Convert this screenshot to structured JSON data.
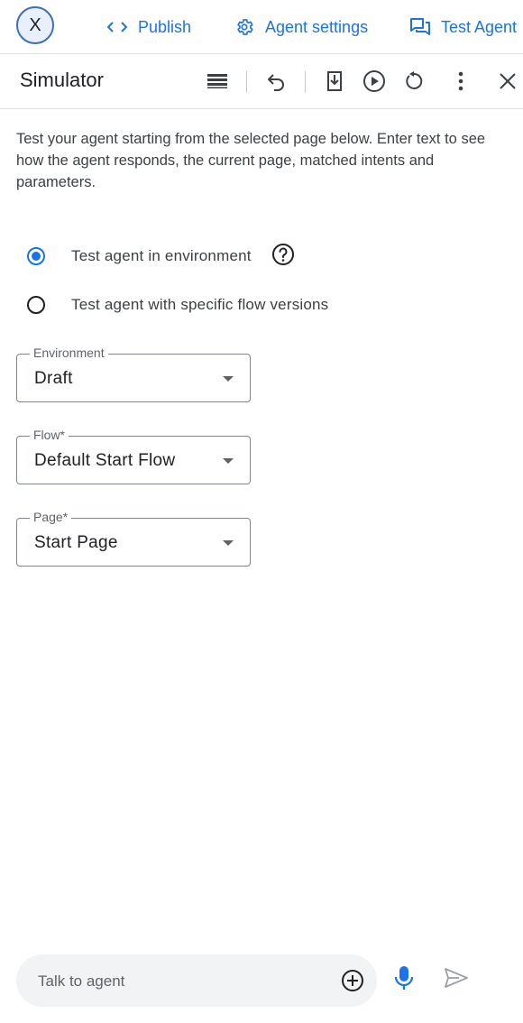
{
  "topbar": {
    "avatar_letter": "X",
    "publish_label": "Publish",
    "agent_settings_label": "Agent settings",
    "test_agent_label": "Test Agent",
    "accent_color": "#1a73e8"
  },
  "simulator": {
    "title": "Simulator",
    "toolbar_icons": [
      "keyboard-icon",
      "undo-icon",
      "download-icon",
      "play-icon",
      "reset-icon",
      "more-vert-icon",
      "close-icon"
    ]
  },
  "description": "Test your agent starting from the selected page below. Enter text to see how the agent responds, the current page, matched intents and parameters.",
  "options": {
    "environment_label": "Test agent in environment",
    "flow_versions_label": "Test agent with specific flow versions",
    "selected": "environment"
  },
  "fields": {
    "environment": {
      "label": "Environment",
      "value": "Draft"
    },
    "flow": {
      "label": "Flow*",
      "value": "Default Start Flow"
    },
    "page": {
      "label": "Page*",
      "value": "Start Page"
    }
  },
  "chat": {
    "placeholder": "Talk to agent"
  }
}
